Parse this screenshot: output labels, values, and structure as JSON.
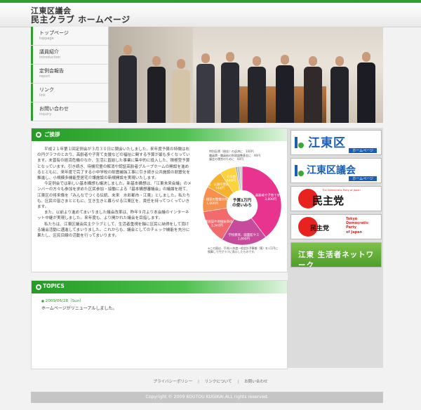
{
  "header": {
    "title_line1": "江東区議会",
    "title_line2": "民主クラブ ホームページ"
  },
  "nav": [
    {
      "label": "トップページ",
      "sub": "toppage"
    },
    {
      "label": "議員紹介",
      "sub": "introduction"
    },
    {
      "label": "定例会報告",
      "sub": "report"
    },
    {
      "label": "リンク",
      "sub": "link"
    },
    {
      "label": "お問い合わせ",
      "sub": "inquiry"
    }
  ],
  "greeting": {
    "heading": "ご挨拶",
    "paragraphs": [
      "平成２１年第１回定例会が３月３０日に閉会いたしました。来年度予算の特徴は右の円グラフのとおり、高齢者や子育て支援などの福祉に関する予算が最も多くなっています。未曾有の経済危機のなか、生活に直結した事業に集中的に投入した、積極型予算となっています。引き続き、待機児童の解消や認証高齢者グループホームの開設を進めるとともに、来年度で完了する小中学校の耐震補強工事に引き続き公共施設の耐震化を推進し、小規模多機能型居宅介護施設の新規開設を実現いたします。",
      "今定例会では新しい基本構想も議決しました。新基本構想は、「江東未来会議」のメンバーの方々も参加を求めた区民参加・協働による「基本構想審議会」の議論を経て、江東区の将来像を『みんなでつくる伝統、未来　水彩都市・江東』としました。私たちも、区民の皆さまとともに、生き生きと暮らせる江東区を、責任を持ってつくっていきます。",
      "また、以前より進めてまいりました議会改革は、昨年９月より本会議のインターネット中継が実現しました。来年度も、より開かれた議会を目指します。",
      "私たちは、江東区議会民主クラブとして、生活者重視を軸に区民に納得をして頂ける議会活動に邁進してまいりました。これからも、議会としてのチェック機能を充分に果たし、区民目線の活動を行ってまいります。"
    ]
  },
  "chart_data": {
    "type": "pie",
    "title": "予算1万円の使いみち",
    "slices": [
      {
        "label": "高齢者や子育てを助けることなどに",
        "value": 3800,
        "value_text": "3,800円",
        "color": "#e8348f"
      },
      {
        "label": "学校教育、図書館やスポーツ振興に",
        "value": 1800,
        "value_text": "1,800円",
        "color": "#c74b9c"
      },
      {
        "label": "処理施設や地域振興のために",
        "value": 1340,
        "value_text": "1,340円",
        "color": "#f06a6e"
      },
      {
        "label": "道路・橋梁の整備や防災対策事業などに",
        "value": 1000,
        "value_text": "1,000円",
        "color": "#f78f4e"
      },
      {
        "label": "道路、公園の整備やまちづくりに",
        "value": 740,
        "value_text": "740円",
        "color": "#f6b12d"
      },
      {
        "label": "その他",
        "value": 640,
        "value_text": "640円",
        "color": "#fcd33a"
      },
      {
        "label": "議会の運営費に",
        "value": 60,
        "value_text": "60円",
        "color": "#999999"
      },
      {
        "label": "特別区債（借金）の返済のために",
        "value": 100,
        "value_text": "100円",
        "color": "#bbbbbb"
      },
      {
        "label": "職員等の人件費と退職手当積立",
        "value": 90,
        "value_text": "90円",
        "color": "#cccccc"
      }
    ],
    "note_top": [
      "特別区債（借金）の返済に　100円",
      "職員費・職員給の財政調整基金に　90円",
      "議会の運営のために　60円"
    ],
    "note_bottom": "※この図は、平成21年度一般会計予算額（案）を1万円に換算して円グラフに表示したものです。"
  },
  "topics": {
    "heading": "TOPICS",
    "items": [
      {
        "date": "2009/06/28（Sun）",
        "text": "ホームページがリニューアルしました。"
      }
    ]
  },
  "banners": {
    "koto": {
      "big": "江東区",
      "sub": "ホームページ"
    },
    "gikai": {
      "big": "江東区議会",
      "sub": "ホームページ"
    },
    "minshu": {
      "big": "民主党",
      "small": "The Democratic Party of Japan"
    },
    "tokyo": {
      "big": "民主党",
      "stack1": "Tokyo",
      "stack2": "Democratic",
      "stack3": "Party",
      "stack4": "of Japan"
    },
    "network": {
      "big": "江東 生活者ネットワーク"
    }
  },
  "footer": {
    "links": [
      "プライバシーポリシー",
      "リンクについて",
      "お問い合わせ"
    ],
    "copyright": "Copyright © 2009 KOUTOU KUGIKAI.ALL rights reserved."
  }
}
